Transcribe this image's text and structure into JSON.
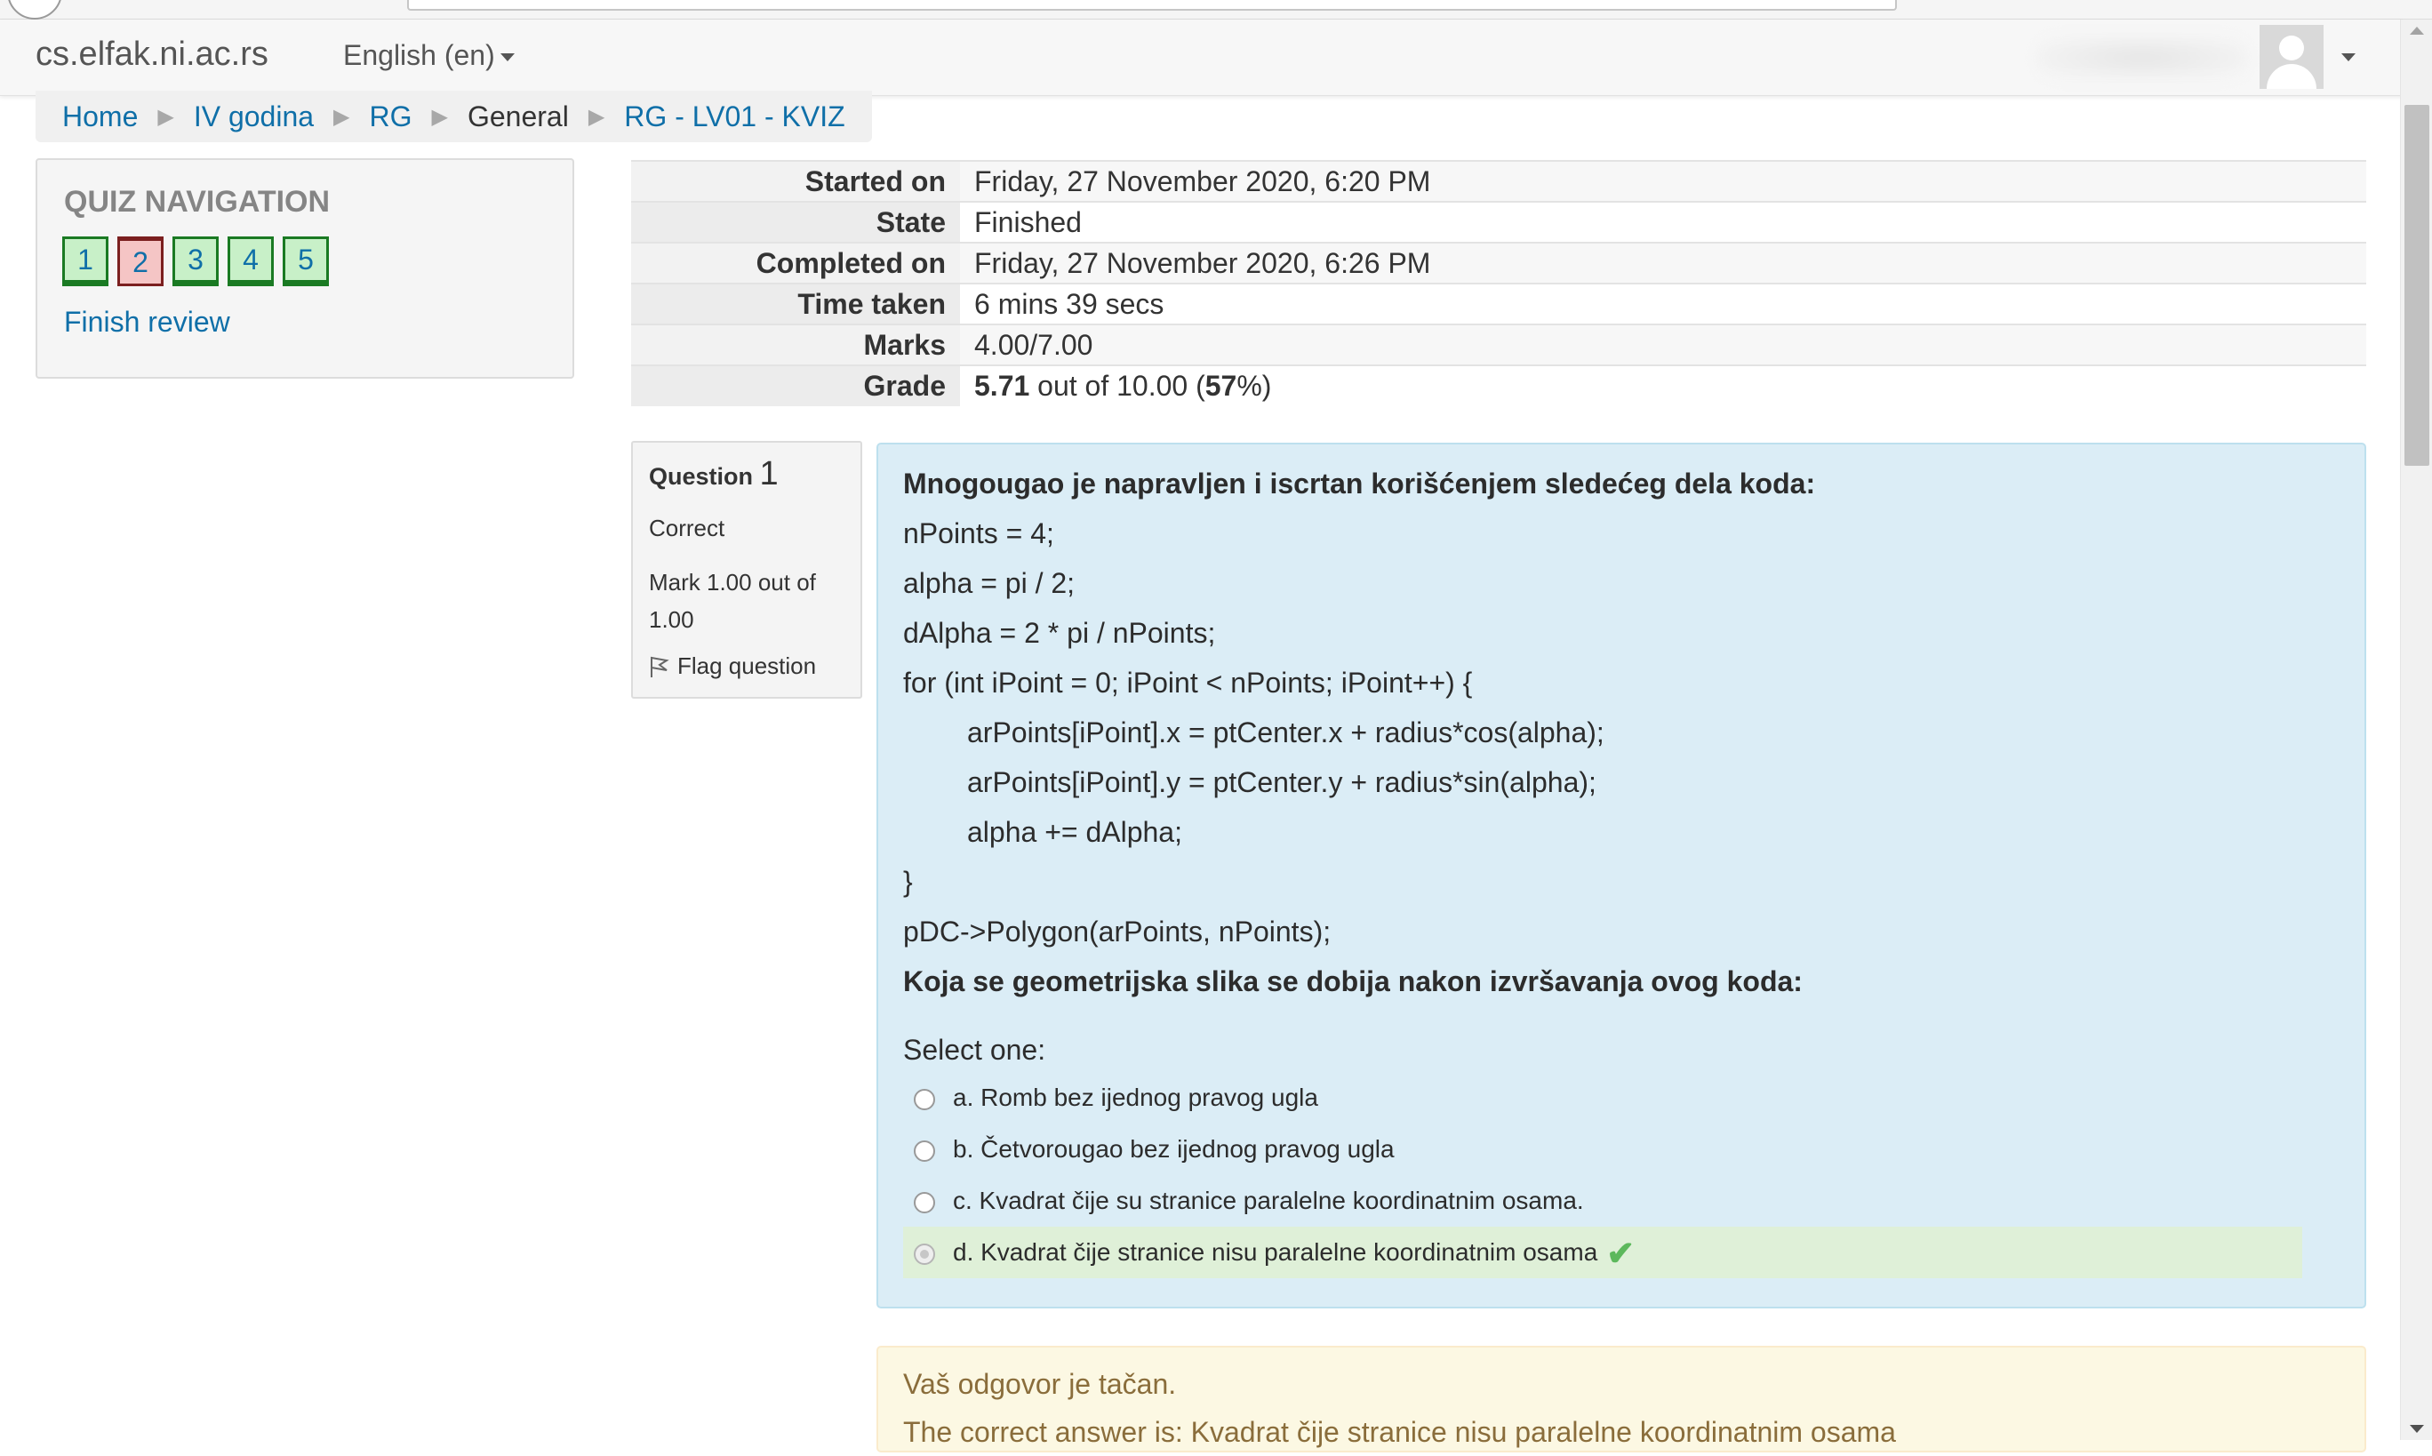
{
  "header": {
    "site_name": "cs.elfak.ni.ac.rs",
    "language": "English ‎(en)‎"
  },
  "breadcrumb": [
    {
      "label": "Home",
      "link": true
    },
    {
      "label": "IV godina",
      "link": true
    },
    {
      "label": "RG",
      "link": true
    },
    {
      "label": "General",
      "link": false
    },
    {
      "label": "RG - LV01 - KVIZ",
      "link": true
    }
  ],
  "quiz_nav": {
    "title": "QUIZ NAVIGATION",
    "questions": [
      {
        "label": "1",
        "state": "correct"
      },
      {
        "label": "2",
        "state": "incorrect"
      },
      {
        "label": "3",
        "state": "correct"
      },
      {
        "label": "4",
        "state": "correct"
      },
      {
        "label": "5",
        "state": "correct"
      }
    ],
    "finish_review": "Finish review"
  },
  "summary": {
    "started_on_label": "Started on",
    "started_on": "Friday, 27 November 2020, 6:20 PM",
    "state_label": "State",
    "state": "Finished",
    "completed_on_label": "Completed on",
    "completed_on": "Friday, 27 November 2020, 6:26 PM",
    "time_taken_label": "Time taken",
    "time_taken": "6 mins 39 secs",
    "marks_label": "Marks",
    "marks": "4.00/7.00",
    "grade_label": "Grade",
    "grade_value": "5.71",
    "grade_out_of": " out of 10.00 (",
    "grade_percent": "57",
    "grade_suffix": "%)"
  },
  "question": {
    "label": "Question ",
    "number": "1",
    "state": "Correct",
    "mark": "Mark 1.00 out of 1.00",
    "flag": "Flag question",
    "intro": "Mnogougao je napravljen i iscrtan korišćenjem sledećeg dela koda:",
    "code": {
      "l1": "nPoints = 4;",
      "l2": "alpha = pi / 2;",
      "l3": "dAlpha = 2 * pi / nPoints;",
      "l4": "for (int iPoint = 0; iPoint < nPoints; iPoint++) {",
      "l5": "arPoints[iPoint].x = ptCenter.x + radius*cos(alpha);",
      "l6": "arPoints[iPoint].y = ptCenter.y + radius*sin(alpha);",
      "l7": "alpha += dAlpha;",
      "l8": "}",
      "l9": "pDC->Polygon(arPoints, nPoints);"
    },
    "prompt": "Koja se geometrijska slika se dobija nakon izvršavanja ovog koda:",
    "select_one": "Select one:",
    "answers": [
      {
        "text": "a. Romb bez ijednog pravog ugla",
        "selected": false,
        "correct": false
      },
      {
        "text": "b. Četvorougao bez ijednog pravog ugla",
        "selected": false,
        "correct": false
      },
      {
        "text": "c. Kvadrat čije su stranice paralelne koordinatnim osama.",
        "selected": false,
        "correct": false
      },
      {
        "text": "d. Kvadrat čije stranice nisu paralelne koordinatnim osama",
        "selected": true,
        "correct": true
      }
    ]
  },
  "feedback": {
    "result": "Vaš odgovor je tačan.",
    "correct_answer": "The correct answer is: Kvadrat čije stranice nisu paralelne koordinatnim osama"
  },
  "colors": {
    "link": "#0f6fa8",
    "question_bg": "#dbedf6",
    "correct_answer_bg": "#dff0d8",
    "feedback_bg": "#fcf8e3",
    "feedback_text": "#8a6d3b",
    "nav_correct": "#c8f0c8",
    "nav_incorrect": "#f5c5c5"
  }
}
